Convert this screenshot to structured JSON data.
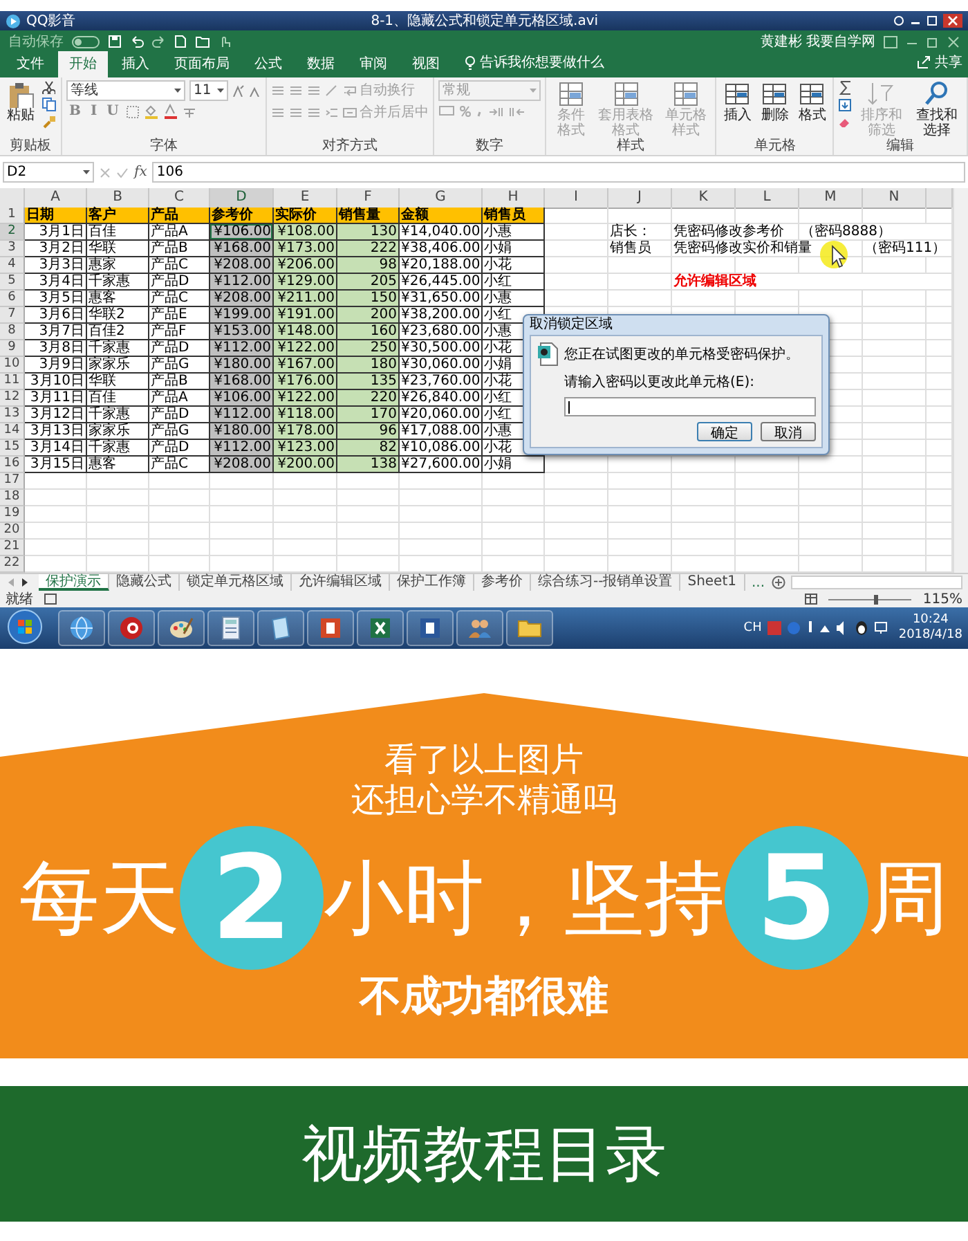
{
  "player": {
    "app": "QQ影音",
    "file": "8-1、隐藏公式和锁定单元格区域.avi"
  },
  "excel": {
    "autosave": "自动保存",
    "autosave_toggle": {
      "on": false
    },
    "user": "黄建彬 我要自学网",
    "tell_me": "告诉我你想要做什么",
    "share": "共享",
    "tabs": [
      {
        "label": "文件",
        "selected": false
      },
      {
        "label": "开始",
        "selected": true
      },
      {
        "label": "插入",
        "selected": false
      },
      {
        "label": "页面布局",
        "selected": false
      },
      {
        "label": "公式",
        "selected": false
      },
      {
        "label": "数据",
        "selected": false
      },
      {
        "label": "审阅",
        "selected": false
      },
      {
        "label": "视图",
        "selected": false
      }
    ],
    "ribbon_groups": [
      {
        "label": "剪贴板",
        "kind": "clipboard",
        "items": [
          {
            "label": "粘贴",
            "disabled": false
          }
        ]
      },
      {
        "label": "字体",
        "kind": "font",
        "font": "等线",
        "size": "11",
        "styles": [
          "B",
          "I",
          "U"
        ]
      },
      {
        "label": "对齐方式",
        "kind": "align",
        "items": [
          {
            "label": "自动换行",
            "disabled": true
          },
          {
            "label": "合并后居中",
            "disabled": true
          }
        ]
      },
      {
        "label": "数字",
        "kind": "number",
        "format": "常规"
      },
      {
        "label": "样式",
        "kind": "large",
        "items": [
          {
            "label": "条件格式",
            "disabled": true
          },
          {
            "label": "套用表格格式",
            "disabled": true
          },
          {
            "label": "单元格样式",
            "disabled": true
          }
        ]
      },
      {
        "label": "单元格",
        "kind": "large",
        "items": [
          {
            "label": "插入",
            "disabled": false
          },
          {
            "label": "删除",
            "disabled": false
          },
          {
            "label": "格式",
            "disabled": false
          }
        ]
      },
      {
        "label": "编辑",
        "kind": "editing",
        "items": [
          {
            "label": "排序和筛选",
            "disabled": true
          },
          {
            "label": "查找和选择",
            "disabled": false
          }
        ]
      }
    ]
  },
  "sheet": {
    "name_box": "D2",
    "function_label": "fx",
    "formula": "106",
    "columns": [
      {
        "letter": "A",
        "kind": "numeric",
        "selected": false
      },
      {
        "letter": "B",
        "kind": "text",
        "selected": false
      },
      {
        "letter": "C",
        "kind": "text",
        "selected": false
      },
      {
        "letter": "D",
        "kind": "locked",
        "selected": true
      },
      {
        "letter": "E",
        "kind": "editable",
        "selected": false
      },
      {
        "letter": "F",
        "kind": "editable",
        "selected": false
      },
      {
        "letter": "G",
        "kind": "numeric",
        "selected": false
      },
      {
        "letter": "H",
        "kind": "text",
        "selected": false
      },
      {
        "letter": "I",
        "kind": "text",
        "selected": false
      },
      {
        "letter": "J",
        "kind": "text",
        "selected": false
      },
      {
        "letter": "K",
        "kind": "text",
        "selected": false
      },
      {
        "letter": "L",
        "kind": "text",
        "selected": false
      },
      {
        "letter": "M",
        "kind": "text",
        "selected": false
      },
      {
        "letter": "N",
        "kind": "text",
        "selected": false
      }
    ],
    "rows": [
      {
        "number": "1",
        "kind": "header",
        "selected": false,
        "cells": {
          "A": "日期",
          "B": "客户",
          "C": "产品",
          "D": "参考价",
          "E": "实际价",
          "F": "销售量",
          "G": "金额",
          "H": "销售员"
        }
      },
      {
        "number": "2",
        "kind": "data",
        "selected": true,
        "cells": {
          "A": "3月1日",
          "B": "百佳",
          "C": "产品A",
          "D": "¥106.00",
          "E": "¥108.00",
          "F": "130",
          "G": "¥14,040.00",
          "H": "小惠"
        },
        "notes": {
          "J": "店长：",
          "K": "凭密码修改参考价",
          "M": "（密码8888）"
        }
      },
      {
        "number": "3",
        "kind": "data",
        "selected": false,
        "cells": {
          "A": "3月2日",
          "B": "华联",
          "C": "产品B",
          "D": "¥168.00",
          "E": "¥173.00",
          "F": "222",
          "G": "¥38,406.00",
          "H": "小娟"
        },
        "notes": {
          "J": "销售员",
          "K": "凭密码修改实价和销量",
          "N": "（密码111）"
        }
      },
      {
        "number": "4",
        "kind": "data",
        "selected": false,
        "cells": {
          "A": "3月3日",
          "B": "惠家",
          "C": "产品C",
          "D": "¥208.00",
          "E": "¥206.00",
          "F": "98",
          "G": "¥20,188.00",
          "H": "小花"
        }
      },
      {
        "number": "5",
        "kind": "data",
        "selected": false,
        "cells": {
          "A": "3月4日",
          "B": "千家惠",
          "C": "产品D",
          "D": "¥112.00",
          "E": "¥129.00",
          "F": "205",
          "G": "¥26,445.00",
          "H": "小红"
        },
        "alerts": {
          "K": "允许编辑区域"
        }
      },
      {
        "number": "6",
        "kind": "data",
        "selected": false,
        "cells": {
          "A": "3月5日",
          "B": "惠客",
          "C": "产品C",
          "D": "¥208.00",
          "E": "¥211.00",
          "F": "150",
          "G": "¥31,650.00",
          "H": "小惠"
        }
      },
      {
        "number": "7",
        "kind": "data",
        "selected": false,
        "cells": {
          "A": "3月6日",
          "B": "华联2",
          "C": "产品E",
          "D": "¥199.00",
          "E": "¥191.00",
          "F": "200",
          "G": "¥38,200.00",
          "H": "小红"
        }
      },
      {
        "number": "8",
        "kind": "data",
        "selected": false,
        "cells": {
          "A": "3月7日",
          "B": "百佳2",
          "C": "产品F",
          "D": "¥153.00",
          "E": "¥148.00",
          "F": "160",
          "G": "¥23,680.00",
          "H": "小惠"
        }
      },
      {
        "number": "9",
        "kind": "data",
        "selected": false,
        "cells": {
          "A": "3月8日",
          "B": "千家惠",
          "C": "产品D",
          "D": "¥112.00",
          "E": "¥122.00",
          "F": "250",
          "G": "¥30,500.00",
          "H": "小花"
        }
      },
      {
        "number": "10",
        "kind": "data",
        "selected": false,
        "cells": {
          "A": "3月9日",
          "B": "家家乐",
          "C": "产品G",
          "D": "¥180.00",
          "E": "¥167.00",
          "F": "180",
          "G": "¥30,060.00",
          "H": "小娟"
        }
      },
      {
        "number": "11",
        "kind": "data",
        "selected": false,
        "cells": {
          "A": "3月10日",
          "B": "华联",
          "C": "产品B",
          "D": "¥168.00",
          "E": "¥176.00",
          "F": "135",
          "G": "¥23,760.00",
          "H": "小花"
        }
      },
      {
        "number": "12",
        "kind": "data",
        "selected": false,
        "cells": {
          "A": "3月11日",
          "B": "百佳",
          "C": "产品A",
          "D": "¥106.00",
          "E": "¥122.00",
          "F": "220",
          "G": "¥26,840.00",
          "H": "小红"
        }
      },
      {
        "number": "13",
        "kind": "data",
        "selected": false,
        "cells": {
          "A": "3月12日",
          "B": "千家惠",
          "C": "产品D",
          "D": "¥112.00",
          "E": "¥118.00",
          "F": "170",
          "G": "¥20,060.00",
          "H": "小红"
        }
      },
      {
        "number": "14",
        "kind": "data",
        "selected": false,
        "cells": {
          "A": "3月13日",
          "B": "家家乐",
          "C": "产品G",
          "D": "¥180.00",
          "E": "¥178.00",
          "F": "96",
          "G": "¥17,088.00",
          "H": "小惠"
        }
      },
      {
        "number": "15",
        "kind": "data",
        "selected": false,
        "cells": {
          "A": "3月14日",
          "B": "千家惠",
          "C": "产品D",
          "D": "¥112.00",
          "E": "¥123.00",
          "F": "82",
          "G": "¥10,086.00",
          "H": "小花"
        }
      },
      {
        "number": "16",
        "kind": "data",
        "selected": false,
        "cells": {
          "A": "3月15日",
          "B": "惠客",
          "C": "产品C",
          "D": "¥208.00",
          "E": "¥200.00",
          "F": "138",
          "G": "¥27,600.00",
          "H": "小娟"
        }
      },
      {
        "number": "17",
        "kind": "empty",
        "selected": false
      },
      {
        "number": "18",
        "kind": "empty",
        "selected": false
      },
      {
        "number": "19",
        "kind": "empty",
        "selected": false
      },
      {
        "number": "20",
        "kind": "empty",
        "selected": false
      },
      {
        "number": "21",
        "kind": "empty",
        "selected": false
      },
      {
        "number": "22",
        "kind": "empty",
        "selected": false
      }
    ],
    "dialog": {
      "title": "取消锁定区域",
      "message": "您正在试图更改的单元格受密码保护。",
      "prompt": "请输入密码以更改此单元格(E):",
      "buttons": [
        "确定",
        "取消"
      ]
    },
    "sheet_tabs": [
      {
        "label": "保护演示",
        "selected": true
      },
      {
        "label": "隐藏公式",
        "selected": false
      },
      {
        "label": "锁定单元格区域",
        "selected": false
      },
      {
        "label": "允许编辑区域",
        "selected": false
      },
      {
        "label": "保护工作簿",
        "selected": false
      },
      {
        "label": "参考价",
        "selected": false
      },
      {
        "label": "综合练习--报销单设置",
        "selected": false
      },
      {
        "label": "Sheet1",
        "selected": false
      }
    ],
    "more_tabs": "...",
    "status": {
      "text": "就绪",
      "zoom": {
        "level": 0.55,
        "reading": "115%"
      }
    }
  },
  "taskbar": {
    "language": "CH",
    "time": "10:24",
    "date": "2018/4/18"
  },
  "banner": {
    "lines": [
      "看了以上图片",
      "还担心学不精通吗"
    ],
    "slogan": [
      {
        "kind": "text",
        "text": "每天"
      },
      {
        "kind": "number",
        "text": "2"
      },
      {
        "kind": "text",
        "text": "小时，坚持"
      },
      {
        "kind": "number",
        "text": "5"
      },
      {
        "kind": "text",
        "text": "周"
      }
    ],
    "tagline": "不成功都很难"
  },
  "footer": {
    "title": "视频教程目录"
  }
}
